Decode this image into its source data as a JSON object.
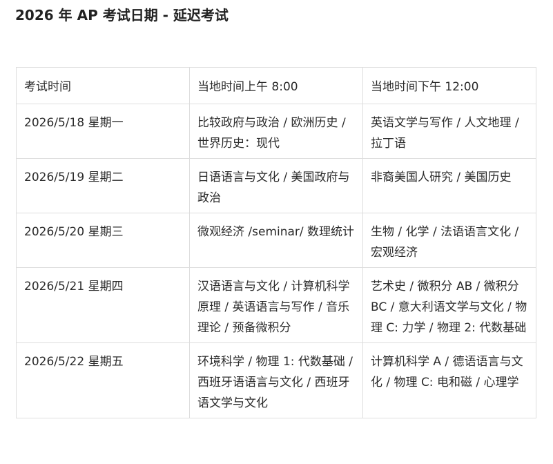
{
  "page": {
    "title": "2026 年 AP 考试日期 - 延迟考试"
  },
  "table": {
    "headers": [
      "考试时间",
      "当地时间上午 8:00",
      "当地时间下午 12:00"
    ],
    "rows": [
      {
        "date": "2026/5/18 星期一",
        "morning": "比较政府与政治 / 欧洲历史 / 世界历史：现代",
        "afternoon": "英语文学与写作 / 人文地理 / 拉丁语"
      },
      {
        "date": "2026/5/19 星期二",
        "morning": "日语语言与文化 / 美国政府与政治",
        "afternoon": "非裔美国人研究 / 美国历史"
      },
      {
        "date": "2026/5/20 星期三",
        "morning": "微观经济 /seminar/ 数理统计",
        "afternoon": "生物 / 化学 / 法语语言文化 / 宏观经济"
      },
      {
        "date": "2026/5/21 星期四",
        "morning": "汉语语言与文化 / 计算机科学原理 / 英语语言与写作 / 音乐理论 / 预备微积分",
        "afternoon": "艺术史 / 微积分 AB / 微积分 BC / 意大利语文学与文化 / 物理 C: 力学 / 物理 2: 代数基础"
      },
      {
        "date": "2026/5/22 星期五",
        "morning": "环境科学 / 物理 1: 代数基础 / 西班牙语语言与文化 / 西班牙语文学与文化",
        "afternoon": "计算机科学 A / 德语语言与文化 / 物理 C: 电和磁 / 心理学"
      }
    ]
  }
}
